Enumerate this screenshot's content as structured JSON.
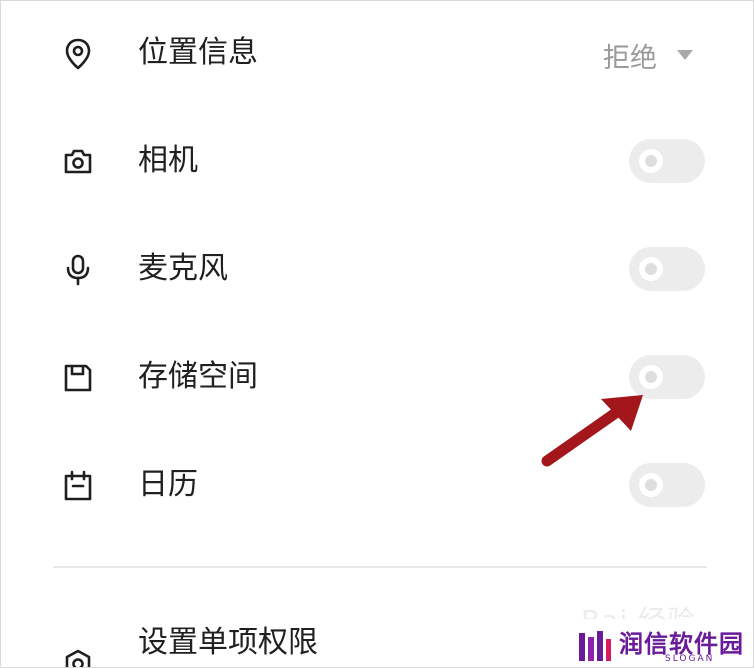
{
  "permissions": [
    {
      "id": "location",
      "label": "位置信息",
      "icon": "location-pin-icon",
      "control": "dropdown",
      "value": "拒绝"
    },
    {
      "id": "camera",
      "label": "相机",
      "icon": "camera-icon",
      "control": "toggle",
      "enabled": false
    },
    {
      "id": "microphone",
      "label": "麦克风",
      "icon": "microphone-icon",
      "control": "toggle",
      "enabled": false
    },
    {
      "id": "storage",
      "label": "存储空间",
      "icon": "storage-icon",
      "control": "toggle",
      "enabled": false
    },
    {
      "id": "calendar",
      "label": "日历",
      "icon": "calendar-icon",
      "control": "toggle",
      "enabled": false
    }
  ],
  "settings_row": {
    "label": "设置单项权限",
    "icon": "settings-icon"
  },
  "annotation": {
    "icon": "red-arrow-annotation",
    "color": "#a3161c",
    "points_to": "storage"
  },
  "watermark": {
    "text": "Bai 经验"
  },
  "brand": {
    "name": "润信软件园",
    "slogan": "SLOGAN",
    "color": "#6a1b9a"
  },
  "colors": {
    "toggle_off": "#ececec",
    "label_text": "#202020",
    "value_text": "#9a9a9a"
  }
}
